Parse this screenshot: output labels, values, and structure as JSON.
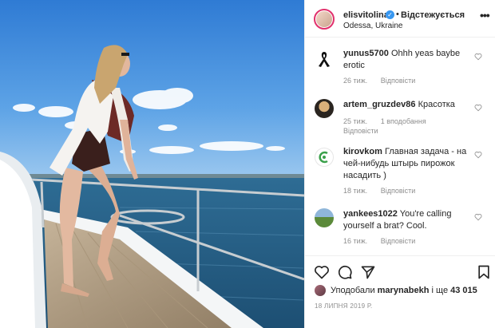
{
  "post": {
    "username": "elisvitolina",
    "follow_separator": "•",
    "follow_label": "Відстежується",
    "location": "Odessa, Ukraine",
    "more_label": "•••",
    "verified_glyph": "✓"
  },
  "comments": [
    {
      "username": "yunus5700",
      "text": "Ohhh yeas baybe erotic",
      "age": "26 тиж.",
      "likes": "",
      "reply_label": "Відповісти",
      "avatar_icon": "black-ribbon-icon"
    },
    {
      "username": "artem_gruzdev86",
      "text": "Красотка",
      "age": "25 тиж.",
      "likes": "1 вподобання",
      "reply_label": "Відповісти",
      "avatar_icon": "avatar-photo"
    },
    {
      "username": "kirovkom",
      "text": "Главная задача - на чей-нибудь штырь пирожок насадить )",
      "age": "18 тиж.",
      "likes": "",
      "reply_label": "Відповісти",
      "avatar_icon": "green-logo-avatar"
    },
    {
      "username": "yankees1022",
      "text": "You're calling yourself a brat? Cool.",
      "age": "16 тиж.",
      "likes": "",
      "reply_label": "Відповісти",
      "avatar_icon": "avatar-photo"
    }
  ],
  "likes": {
    "prefix": "Уподобали",
    "user": "marynabekh",
    "and_label": "і ще",
    "count": "43 015"
  },
  "date": "18 ЛИПНЯ 2019 Р.",
  "colors": {
    "accent_blue": "#3897f0",
    "text": "#262626",
    "muted": "#8e8e8e",
    "border": "#efefef"
  }
}
